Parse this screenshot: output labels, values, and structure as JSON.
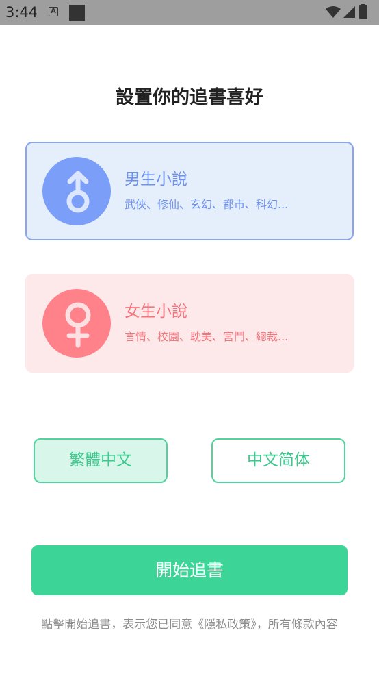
{
  "status_bar": {
    "time": "3:44",
    "icons": [
      "a-notification-icon",
      "square-notification-icon",
      "wifi-icon",
      "signal-icon",
      "battery-icon"
    ]
  },
  "title": "設置你的追書喜好",
  "cards": {
    "male": {
      "icon": "male-symbol-icon",
      "title": "男生小說",
      "tags": "武俠、修仙、玄幻、都市、科幻...",
      "selected": true
    },
    "female": {
      "icon": "female-symbol-icon",
      "title": "女生小說",
      "tags": "言情、校園、耽美、宮鬥、總裁...",
      "selected": false
    }
  },
  "language": {
    "traditional": "繁體中文",
    "simplified": "中文简体",
    "selected": "traditional"
  },
  "start_button": "開始追書",
  "footer": {
    "prefix": "點擊開始追書，表示您已同意《",
    "link": "隱私政策",
    "suffix": "》，所有條款內容"
  },
  "colors": {
    "accent_green": "#3dd498",
    "male_blue": "#7b9ff8",
    "female_pink": "#ff8189",
    "status_bar": "#9e9e9e"
  }
}
